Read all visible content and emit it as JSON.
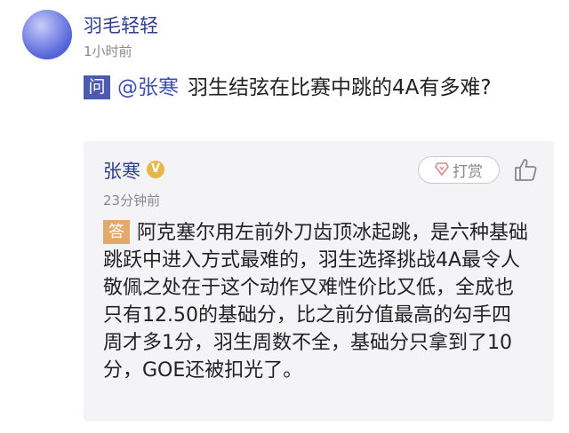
{
  "post": {
    "username": "羽毛轻轻",
    "time": "1小时前"
  },
  "question": {
    "badge": "问",
    "mention": "@张寒",
    "text": "羽生结弦在比赛中跳的4A有多难?"
  },
  "answer": {
    "author": "张寒",
    "verified_badge": "V",
    "tip_label": "打赏",
    "time": "23分钟前",
    "badge": "答",
    "text": "阿克塞尔用左前外刀齿顶冰起跳，是六种基础跳跃中进入方式最难的，羽生选择挑战4A最令人敬佩之处在于这个动作又难性价比又低，全成也只有12.50的基础分，比之前分值最高的勾手四周才多1分，羽生周数不全，基础分只拿到了10分，GOE还被扣光了。"
  },
  "icons": {
    "tip": "diamond-icon",
    "like": "thumbs-up-icon"
  },
  "colors": {
    "accent": "#2f3f8f",
    "question_badge": "#4d5ab2",
    "answer_badge": "#e3a96a",
    "card_bg": "#f4f4f7"
  }
}
